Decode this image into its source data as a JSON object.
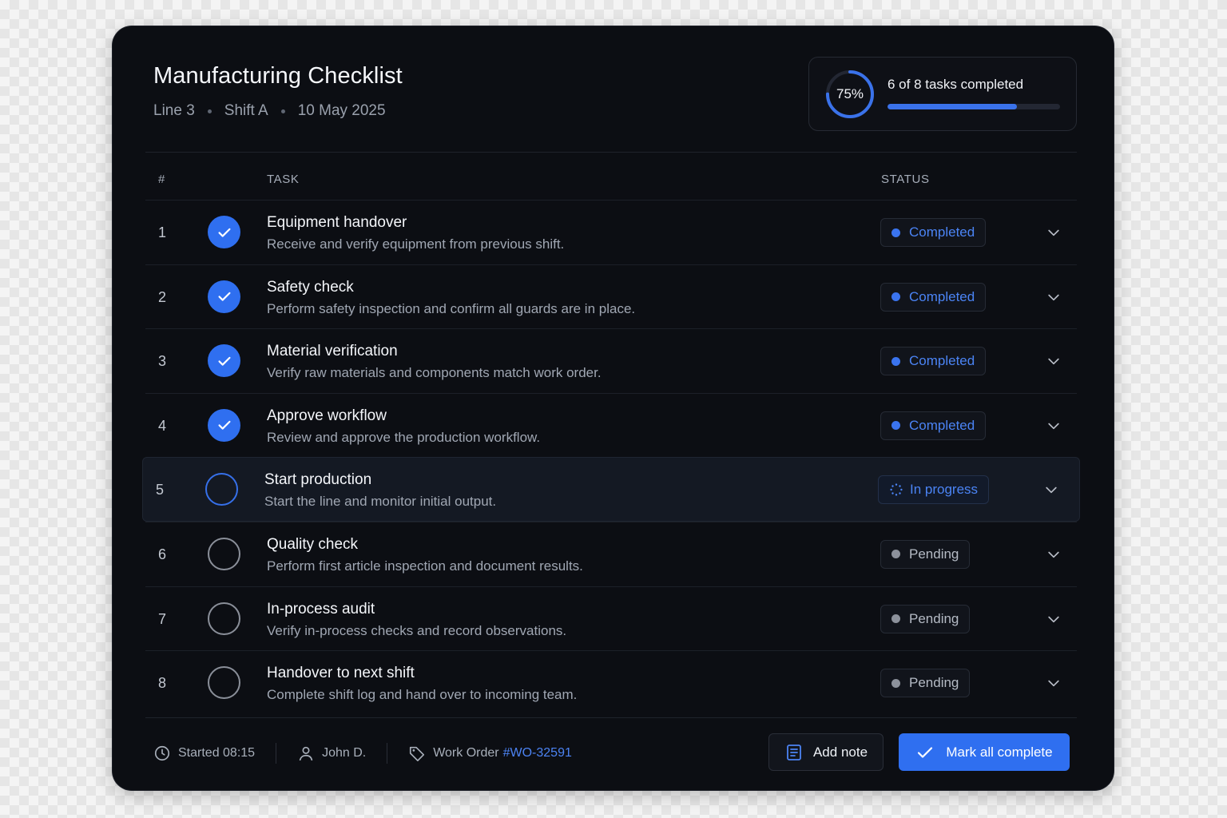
{
  "header": {
    "title": "Manufacturing Checklist",
    "line": "Line 3",
    "shift": "Shift A",
    "date": "10 May 2025"
  },
  "progress": {
    "percent_label": "75%",
    "fraction": 0.75,
    "summary": "6 of 8 tasks completed"
  },
  "table": {
    "col_num": "#",
    "col_task": "TASK",
    "col_status": "STATUS"
  },
  "tasks": [
    {
      "num": "1",
      "title": "Equipment handover",
      "desc": "Receive and verify equipment from previous shift.",
      "state": "done",
      "status": "Completed"
    },
    {
      "num": "2",
      "title": "Safety check",
      "desc": "Perform safety inspection and confirm all guards are in place.",
      "state": "done",
      "status": "Completed"
    },
    {
      "num": "3",
      "title": "Material verification",
      "desc": "Verify raw materials and components match work order.",
      "state": "done",
      "status": "Completed"
    },
    {
      "num": "4",
      "title": "Approve workflow",
      "desc": "Review and approve the production workflow.",
      "state": "done",
      "status": "Completed"
    },
    {
      "num": "5",
      "title": "Start production",
      "desc": "Start the line and monitor initial output.",
      "state": "current",
      "status": "In progress"
    },
    {
      "num": "6",
      "title": "Quality check",
      "desc": "Perform first article inspection and document results.",
      "state": "todo",
      "status": "Pending"
    },
    {
      "num": "7",
      "title": "In-process audit",
      "desc": "Verify in-process checks and record observations.",
      "state": "todo",
      "status": "Pending"
    },
    {
      "num": "8",
      "title": "Handover to next shift",
      "desc": "Complete shift log and hand over to incoming team.",
      "state": "todo",
      "status": "Pending"
    }
  ],
  "footer": {
    "started": "Started 08:15",
    "operator": "John D.",
    "work_order_label": "Work Order",
    "work_order_id": "#WO-32591",
    "add_note_label": "Add note",
    "mark_all_label": "Mark all complete"
  },
  "colors": {
    "accent": "#2f6ff0",
    "card_bg": "#0c0e13",
    "pending": "#8c919b"
  },
  "icons": {
    "started": "clock-icon",
    "operator": "user-icon",
    "work_order": "tag-icon",
    "add_note": "note-icon",
    "mark_all": "check-icon",
    "row_expand": "chevron-down-icon"
  }
}
